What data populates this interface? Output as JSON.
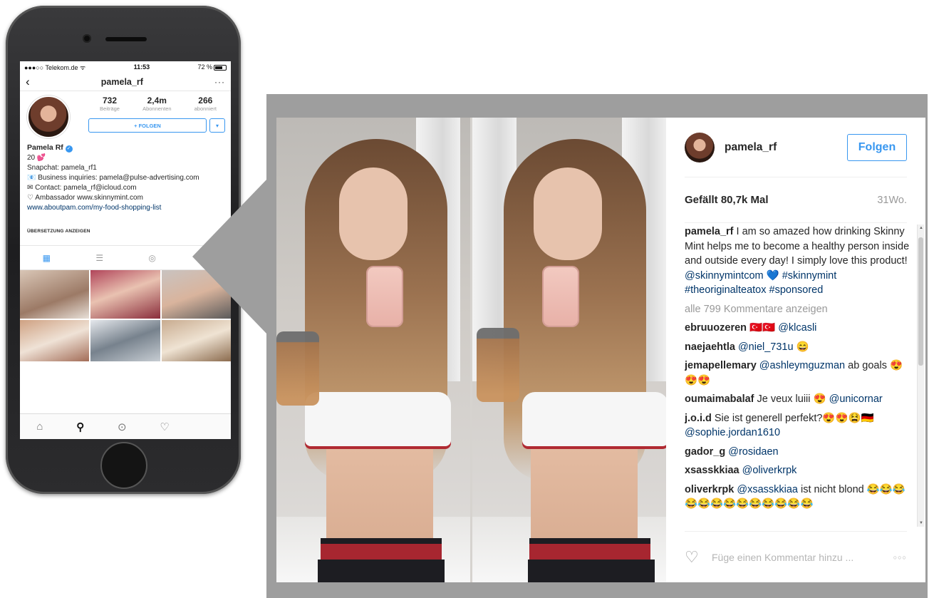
{
  "phone": {
    "status": {
      "carrier": "●●●○○ Telekom.de ᯤ",
      "time": "11:53",
      "battery": "72 %"
    },
    "nav": {
      "back_icon": "chevron-left-icon",
      "title": "pamela_rf",
      "more": "···"
    },
    "stats": [
      {
        "num": "732",
        "label": "Beiträge"
      },
      {
        "num": "2,4m",
        "label": "Abonnenten"
      },
      {
        "num": "266",
        "label": "abonniert"
      }
    ],
    "follow_label": "+ FOLGEN",
    "dropdown_label": "▾",
    "bio": {
      "name": "Pamela Rf",
      "line1": "20 💕",
      "line2": "Snapchat: pamela_rf1",
      "line3": "📧 Business inquiries: pamela@pulse-advertising.com",
      "line4": "✉ Contact: pamela_rf@icloud.com",
      "line5": "♡ Ambassador www.skinnymint.com",
      "link": "www.aboutpam.com/my-food-shopping-list"
    },
    "translate_label": "ÜBERSETZUNG ANZEIGEN",
    "tabbar": {
      "home": "⌂",
      "search": "⚲",
      "camera": "⊙",
      "heart": "♡"
    }
  },
  "post": {
    "username": "pamela_rf",
    "follow_label": "Folgen",
    "likes": "Gefällt 80,7k Mal",
    "age": "31Wo.",
    "caption_user": "pamela_rf",
    "caption_text": " I am so amazed how drinking Skinny Mint helps me to become a healthy person inside and outside every day! I simply love this product! ",
    "caption_tags": "@skinnymintcom 💙 #skinnymint #theoriginalteatox #sponsored",
    "view_all": "alle 799 Kommentare anzeigen",
    "comments": [
      {
        "user": "ebruuozeren",
        "text": " 🇹🇷🇹🇷 ",
        "tag": "@klcasli"
      },
      {
        "user": "naejaehtla",
        "text": " ",
        "tag": "@niel_731u",
        "after": " 😄"
      },
      {
        "user": "jemapellemary",
        "text": " ",
        "tag": "@ashleymguzman",
        "after": " ab goals 😍😍😍"
      },
      {
        "user": "oumaimabalaf",
        "text": " Je veux luiii 😍 ",
        "tag": "@unicornar"
      },
      {
        "user": "j.o.i.d",
        "text": " Sie ist generell perfekt?😍😍😫🇩🇪 ",
        "tag": "@sophie.jordan1610"
      },
      {
        "user": "gador_g",
        "text": " ",
        "tag": "@rosidaen"
      },
      {
        "user": "xsasskkiaa",
        "text": " ",
        "tag": "@oliverkrpk"
      },
      {
        "user": "oliverkrpk",
        "text": " ",
        "tag": "@xsasskkiaa",
        "after": " ist nicht blond 😂😂😂😂😂😂😂😂😂😂😂😂😂"
      }
    ],
    "comment_placeholder": "Füge einen Kommentar hinzu ...",
    "more_dots": "○○○"
  }
}
